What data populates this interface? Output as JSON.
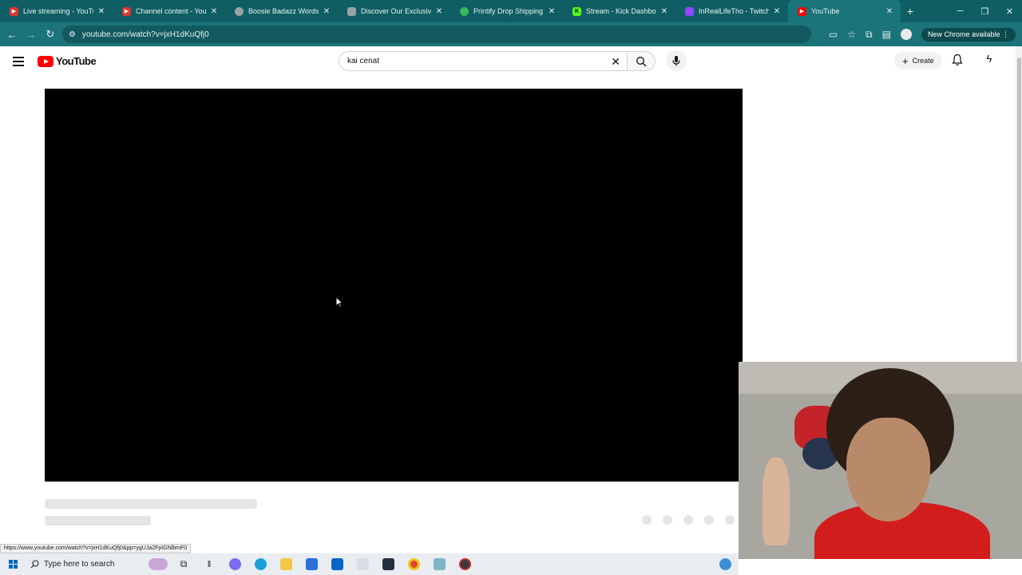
{
  "browser": {
    "tabs": [
      {
        "title": "Live streaming - YouTube",
        "icon": "youtube-studio-icon",
        "color": "#e3342f",
        "active": false
      },
      {
        "title": "Channel content - YouTube",
        "icon": "youtube-studio-icon",
        "color": "#e3342f",
        "active": false
      },
      {
        "title": "Boosie Badazz Words Of Am",
        "icon": "globe-icon",
        "color": "#9aa0a6",
        "active": false
      },
      {
        "title": "Discover Our Exclusive Ran",
        "icon": "page-icon",
        "color": "#9aa0a6",
        "active": false
      },
      {
        "title": "Printify Drop Shipping Prin",
        "icon": "printify-icon",
        "color": "#39b75d",
        "active": false
      },
      {
        "title": "Stream - Kick Dashboard",
        "icon": "kick-icon",
        "color": "#53fc18",
        "active": false
      },
      {
        "title": "InRealLifeTho - Twitch",
        "icon": "twitch-icon",
        "color": "#9146ff",
        "active": false
      },
      {
        "title": "YouTube",
        "icon": "youtube-icon",
        "color": "#ff0000",
        "active": true
      }
    ],
    "close_glyph": "✕",
    "new_tab_glyph": "+",
    "url": "youtube.com/watch?v=jxH1dKuQfj0",
    "new_chrome_label": "New Chrome available",
    "status_url": "https://www.youtube.com/watch?v=jxH1dKuQfj0&pp=ygUJa2FpIGNlbmF0"
  },
  "youtube": {
    "logo_text": "YouTube",
    "search_value": "kai cenat",
    "create_label": "Create"
  },
  "taskbar": {
    "search_placeholder": "Type here to search"
  }
}
